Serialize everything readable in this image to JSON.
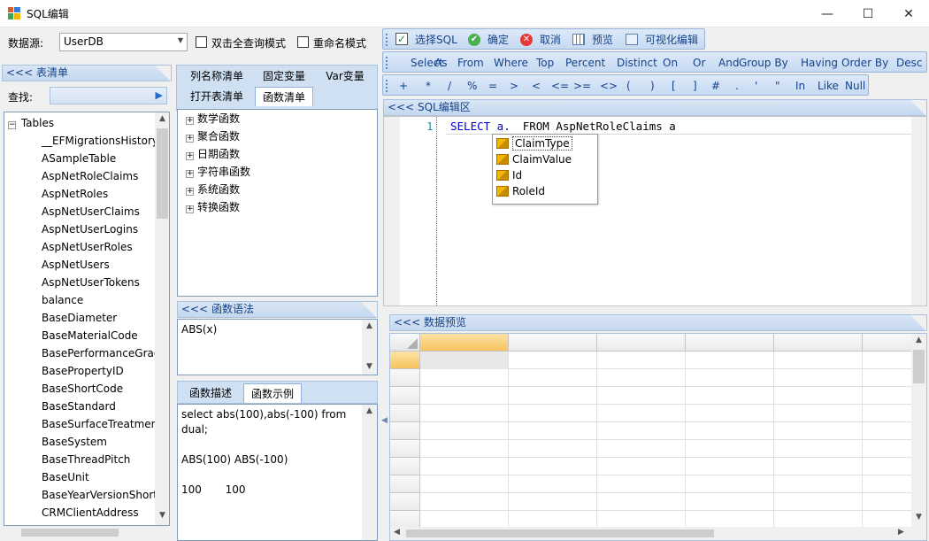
{
  "window": {
    "title": "SQL编辑",
    "min": "—",
    "max": "☐",
    "close": "✕"
  },
  "options": {
    "datasource_label": "数据源:",
    "datasource_value": "UserDB",
    "fullquery_label": "双击全查询模式",
    "rename_label": "重命名模式"
  },
  "left": {
    "header": "<<< 表清单",
    "find_label": "查找:",
    "tree_root": "Tables",
    "tables": [
      "__EFMigrationsHistory",
      "ASampleTable",
      "AspNetRoleClaims",
      "AspNetRoles",
      "AspNetUserClaims",
      "AspNetUserLogins",
      "AspNetUserRoles",
      "AspNetUsers",
      "AspNetUserTokens",
      "balance",
      "BaseDiameter",
      "BaseMaterialCode",
      "BasePerformanceGrade",
      "BasePropertyID",
      "BaseShortCode",
      "BaseStandard",
      "BaseSurfaceTreatment",
      "BaseSystem",
      "BaseThreadPitch",
      "BaseUnit",
      "BaseYearVersionShort",
      "CRMClientAddress"
    ]
  },
  "middle": {
    "tabs_row1": [
      "列名称清单",
      "固定变量",
      "Var变量"
    ],
    "tabs_row2": [
      "打开表清单",
      "函数清单"
    ],
    "functions": [
      "数学函数",
      "聚合函数",
      "日期函数",
      "字符串函数",
      "系统函数",
      "转换函数"
    ],
    "syntax_header": "<<< 函数语法",
    "syntax": "ABS(x)",
    "tabs3": [
      "函数描述",
      "函数示例"
    ],
    "example_lines": [
      "select abs(100),abs(-100) from",
      "dual;",
      "",
      "ABS(100) ABS(-100)",
      "",
      "100       100"
    ]
  },
  "toolbar1": {
    "choose": "选择SQL",
    "ok": "确定",
    "cancel": "取消",
    "preview": "预览",
    "visual": "可视化编辑"
  },
  "keywords": [
    "Select",
    "As",
    "From",
    "Where",
    "Top",
    "Percent",
    "Distinct",
    "On",
    "Or",
    "And",
    "Group By",
    "Having",
    "Order By",
    "Desc"
  ],
  "operators": [
    "+",
    "*",
    "/",
    "%",
    "=",
    ">",
    "<",
    "<=",
    ">=",
    "<>",
    "(",
    ")",
    "[",
    "]",
    "#",
    ".",
    "'",
    "\"",
    "In",
    "Like",
    "Null"
  ],
  "editor": {
    "header": "<<< SQL编辑区",
    "line_no": "1",
    "code_prefix": "SELECT a.",
    "code_rest": "FROM AspNetRoleClaims a",
    "autocomplete": [
      "ClaimType",
      "ClaimValue",
      "Id",
      "RoleId"
    ]
  },
  "preview": {
    "header": "<<< 数据预览"
  },
  "colors": {
    "accent": "#15428b",
    "selection_orange": "#f7c35d"
  }
}
